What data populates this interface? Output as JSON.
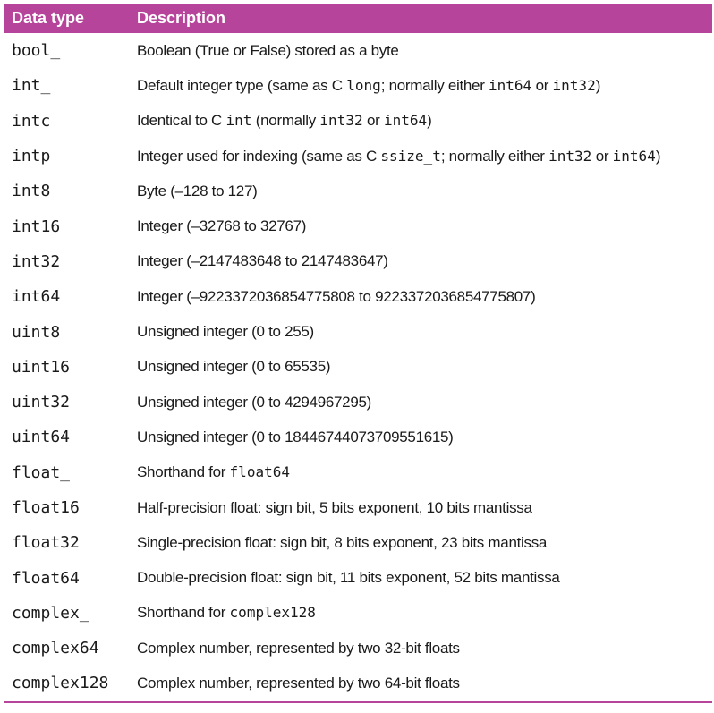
{
  "header": {
    "col_type": "Data type",
    "col_description": "Description"
  },
  "rows": [
    {
      "type": "bool_",
      "description": [
        {
          "t": "Boolean (True or False) stored as a byte"
        }
      ]
    },
    {
      "type": "int_",
      "description": [
        {
          "t": "Default integer type (same as C "
        },
        {
          "c": "long"
        },
        {
          "t": "; normally either "
        },
        {
          "c": "int64"
        },
        {
          "t": " or "
        },
        {
          "c": "int32"
        },
        {
          "t": ")"
        }
      ]
    },
    {
      "type": "intc",
      "description": [
        {
          "t": "Identical to C "
        },
        {
          "c": "int"
        },
        {
          "t": " (normally "
        },
        {
          "c": "int32"
        },
        {
          "t": " or "
        },
        {
          "c": "int64"
        },
        {
          "t": ")"
        }
      ]
    },
    {
      "type": "intp",
      "description": [
        {
          "t": "Integer used for indexing (same as C "
        },
        {
          "c": "ssize_t"
        },
        {
          "t": "; normally either "
        },
        {
          "c": "int32"
        },
        {
          "t": " or "
        },
        {
          "c": "int64"
        },
        {
          "t": ")"
        }
      ]
    },
    {
      "type": "int8",
      "description": [
        {
          "t": "Byte (–128 to 127)"
        }
      ]
    },
    {
      "type": "int16",
      "description": [
        {
          "t": "Integer (–32768 to 32767)"
        }
      ]
    },
    {
      "type": "int32",
      "description": [
        {
          "t": "Integer (–2147483648 to 2147483647)"
        }
      ]
    },
    {
      "type": "int64",
      "description": [
        {
          "t": "Integer (–9223372036854775808 to 9223372036854775807)"
        }
      ]
    },
    {
      "type": "uint8",
      "description": [
        {
          "t": "Unsigned integer (0 to 255)"
        }
      ]
    },
    {
      "type": "uint16",
      "description": [
        {
          "t": "Unsigned integer (0 to 65535)"
        }
      ]
    },
    {
      "type": "uint32",
      "description": [
        {
          "t": "Unsigned integer (0 to 4294967295)"
        }
      ]
    },
    {
      "type": "uint64",
      "description": [
        {
          "t": "Unsigned integer (0 to 18446744073709551615)"
        }
      ]
    },
    {
      "type": "float_",
      "description": [
        {
          "t": "Shorthand for "
        },
        {
          "c": "float64"
        }
      ]
    },
    {
      "type": "float16",
      "description": [
        {
          "t": "Half-precision float: sign bit, 5 bits exponent, 10 bits mantissa"
        }
      ]
    },
    {
      "type": "float32",
      "description": [
        {
          "t": "Single-precision float: sign bit, 8 bits exponent, 23 bits mantissa"
        }
      ]
    },
    {
      "type": "float64",
      "description": [
        {
          "t": "Double-precision float: sign bit, 11 bits exponent, 52 bits mantissa"
        }
      ]
    },
    {
      "type": "complex_",
      "description": [
        {
          "t": "Shorthand for "
        },
        {
          "c": "complex128"
        }
      ]
    },
    {
      "type": "complex64",
      "description": [
        {
          "t": "Complex number, represented by two 32-bit floats"
        }
      ]
    },
    {
      "type": "complex128",
      "description": [
        {
          "t": "Complex number, represented by two 64-bit floats"
        }
      ]
    }
  ],
  "colors": {
    "header_bg": "#b6449a",
    "header_text": "#ffffff",
    "body_text": "#1a1a1a"
  }
}
